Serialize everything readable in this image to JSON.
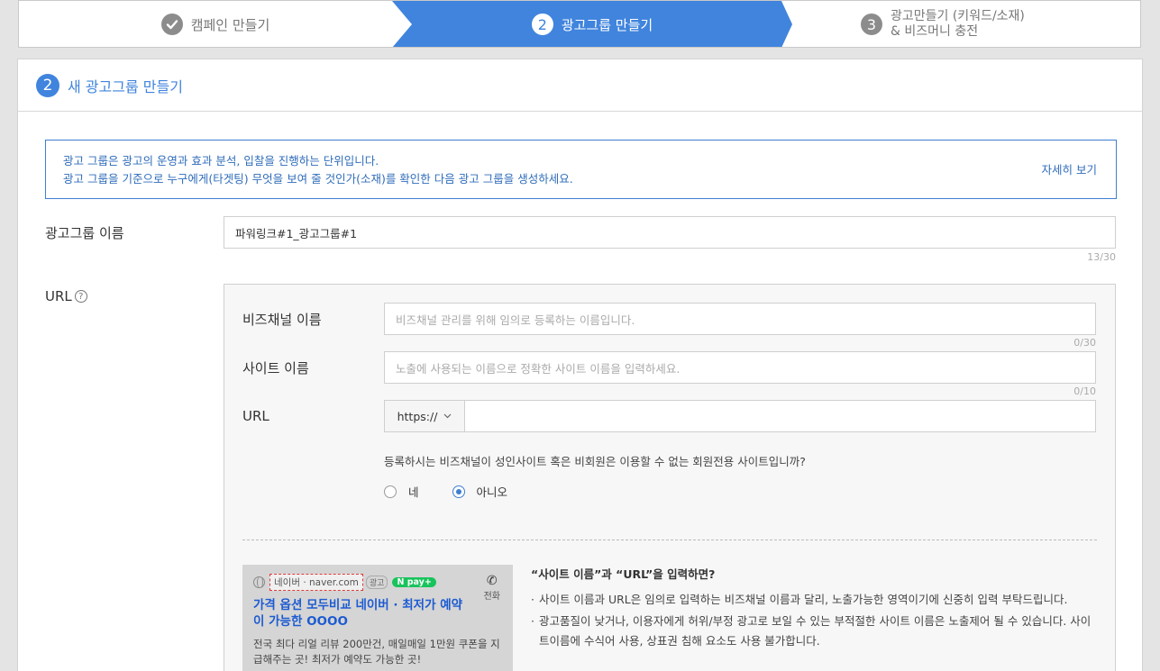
{
  "stepper": {
    "step1": {
      "label": "캠페인 만들기"
    },
    "step2": {
      "num": "2",
      "label": "광고그룹 만들기"
    },
    "step3": {
      "num": "3",
      "label_line1": "광고만들기 (키워드/소재)",
      "label_line2": "& 비즈머니 충전"
    }
  },
  "panel": {
    "num": "2",
    "title": "새 광고그룹 만들기"
  },
  "notice": {
    "line1": "광고 그룹은 광고의 운영과 효과 분석, 입찰을 진행하는 단위입니다.",
    "line2": "광고 그룹을 기준으로 누구에게(타겟팅) 무엇을 보여 줄 것인가(소재)를 확인한 다음 광고 그룹을 생성하세요.",
    "more_link": "자세히 보기"
  },
  "adgroup_name": {
    "label": "광고그룹 이름",
    "value": "파워링크#1_광고그룹#1",
    "counter": "13/30"
  },
  "url_section": {
    "label": "URL",
    "help_glyph": "?",
    "biz_channel": {
      "label": "비즈채널 이름",
      "placeholder": "비즈채널 관리를 위해 임의로 등록하는 이름입니다.",
      "counter": "0/30"
    },
    "site_name": {
      "label": "사이트 이름",
      "placeholder": "노출에 사용되는 이름으로 정확한 사이트 이름을 입력하세요.",
      "counter": "0/10"
    },
    "url": {
      "label": "URL",
      "protocol": "https://",
      "value": ""
    },
    "adult_question": "등록하시는 비즈채널이 성인사이트 혹은 비회원은 이용할 수 없는 회원전용 사이트입니까?",
    "options": [
      {
        "label": "네",
        "selected": false
      },
      {
        "label": "아니오",
        "selected": true
      }
    ]
  },
  "preview": {
    "site": "네이버 · naver.com",
    "ad_badge": "광고",
    "npay": "pay+",
    "phone_label": "전화",
    "title": "가격 옵션 모두비교 네이버 · 최저가 예약이 가능한 OOOO",
    "desc": "전국 최다 리얼 리뷰 200만건, 매일매일 1만원 쿠폰을 지급해주는 곳! 최저가 예약도 가능한 곳!"
  },
  "guide": {
    "heading": "“사이트 이름”과 “URL”을 입력하면?",
    "bullets": [
      "사이트 이름과 URL은 임의로 입력하는 비즈채널 이름과 달리, 노출가능한 영역이기에 신중히 입력 부탁드립니다.",
      "광고품질이 낮거나, 이용자에게 허위/부정 광고로 보일 수 있는 부적절한 사이트 이름은 노출제어 될 수 있습니다. 사이트이름에 수식어 사용, 상표권 침해 요소도 사용 불가합니다."
    ]
  },
  "colors": {
    "accent": "#4084dd",
    "notice_border": "#3e7fd1"
  }
}
